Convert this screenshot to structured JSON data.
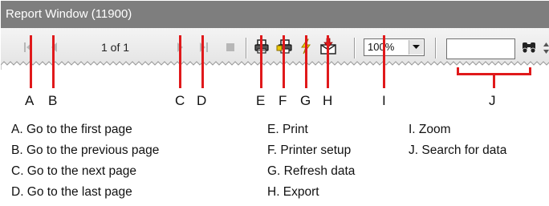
{
  "window": {
    "title": "Report Window (11900)",
    "page_count": "1 of 1",
    "zoom": "100%",
    "search_value": ""
  },
  "toolbar_icons": [
    "first-page-icon",
    "previous-page-icon",
    "next-page-icon",
    "last-page-icon",
    "stop-icon",
    "print-icon",
    "printer-setup-icon",
    "refresh-icon",
    "export-icon",
    "chevron-down-icon",
    "binoculars-icon"
  ],
  "callouts": {
    "letters": [
      "A",
      "B",
      "C",
      "D",
      "E",
      "F",
      "G",
      "H",
      "I",
      "J"
    ]
  },
  "legend": {
    "col1": [
      "A. Go to the first page",
      "B. Go to the previous page",
      "C. Go to the next page",
      "D. Go to the last page"
    ],
    "col2": [
      "E. Print",
      "F. Printer setup",
      "G. Refresh data",
      "H. Export"
    ],
    "col3": [
      "I. Zoom",
      "J. Search for data"
    ]
  },
  "colors": {
    "callout": "#e0191b",
    "titlebar": "#7e7e7e",
    "toolbar": "#ececec"
  }
}
